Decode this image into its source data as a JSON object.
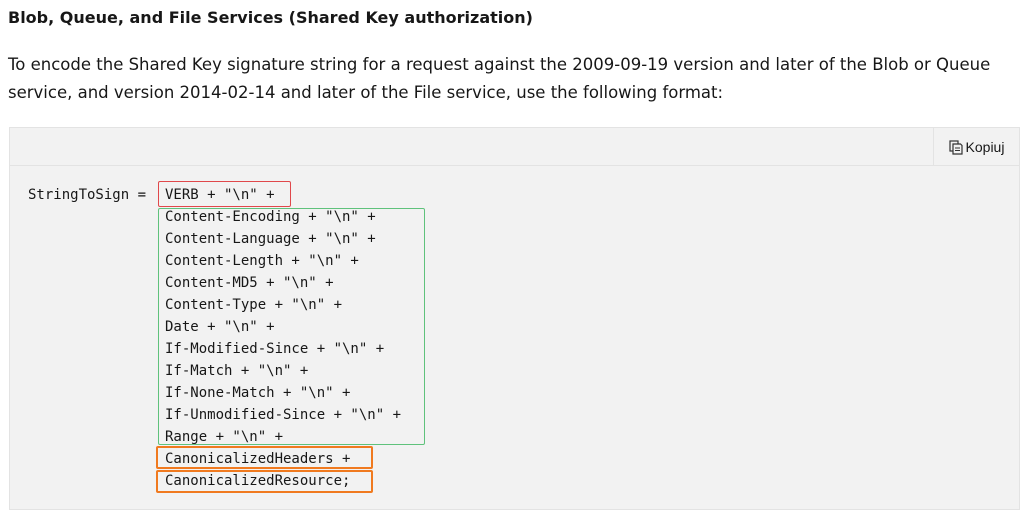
{
  "heading": "Blob, Queue, and File Services (Shared Key authorization)",
  "paragraph": {
    "line1": "To encode the Shared Key signature string for a request against the 2009-09-19 version and later of the Blob or Queue",
    "line2": "service, and version 2014-02-14 and later of the File service, use the following format:"
  },
  "copy_button": {
    "label": "Kopiuj",
    "icon": "copy-icon"
  },
  "code": {
    "prefix": "StringToSign = ",
    "lines": [
      "VERB + \"\\n\" +",
      "Content-Encoding + \"\\n\" +",
      "Content-Language + \"\\n\" +",
      "Content-Length + \"\\n\" +",
      "Content-MD5 + \"\\n\" +",
      "Content-Type + \"\\n\" +",
      "Date + \"\\n\" +",
      "If-Modified-Since + \"\\n\" +",
      "If-Match + \"\\n\" +",
      "If-None-Match + \"\\n\" +",
      "If-Unmodified-Since + \"\\n\" +",
      "Range + \"\\n\" +",
      "CanonicalizedHeaders +",
      "CanonicalizedResource;"
    ]
  },
  "highlight_colors": {
    "verb": "#e0484b",
    "standard_headers": "#5fc27c",
    "canonicalized": "#f07a1f"
  }
}
